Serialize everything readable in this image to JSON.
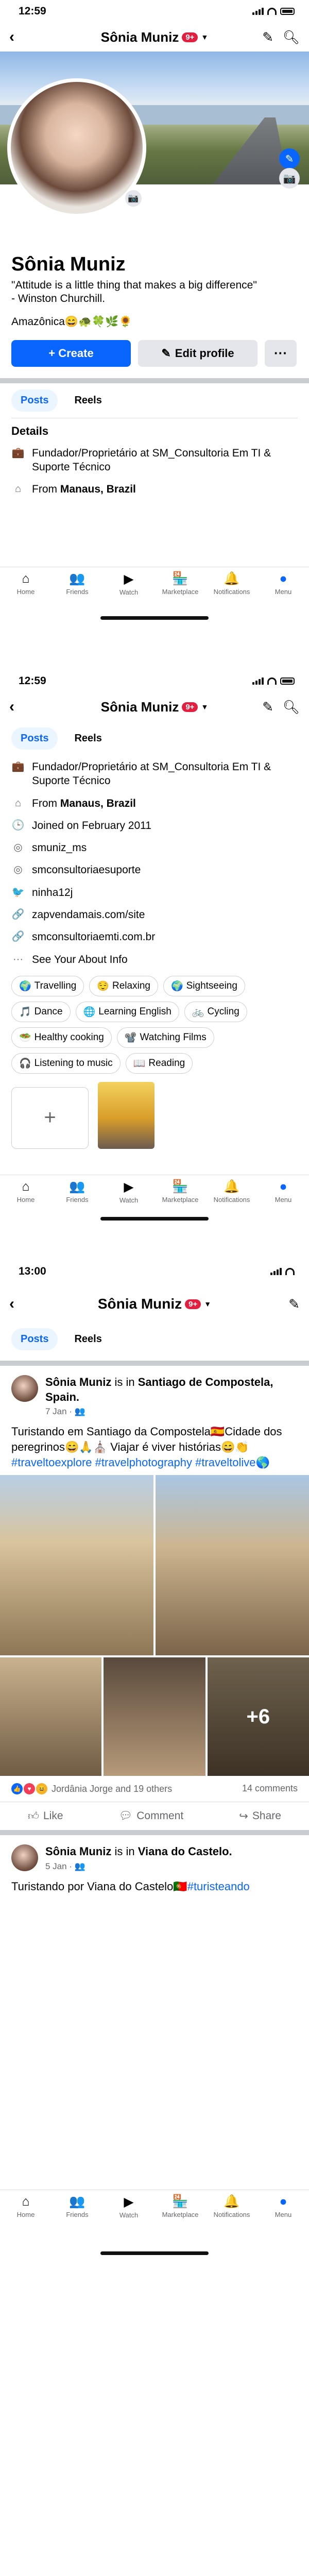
{
  "status": {
    "time_1": "12:59",
    "time_2": "12:59",
    "time_3": "13:00"
  },
  "profile": {
    "name": "Sônia Muniz",
    "badge": "9+",
    "bio": "\"Attitude is a little thing that makes a big difference\"\n- Winston Churchill.",
    "bio_emoji": "Amazônica😄🐢🍀🌿🌻",
    "create_label": "+ Create",
    "edit_label": "Edit profile",
    "more_label": "···"
  },
  "tabs": {
    "posts": "Posts",
    "reels": "Reels"
  },
  "details": {
    "title": "Details",
    "work": "Fundador/Proprietário at SM_Consultoria Em TI & Suporte Técnico",
    "from_prefix": "From ",
    "from_place": "Manaus, Brazil",
    "joined": "Joined on February 2011",
    "instagram": "smuniz_ms",
    "instagram2": "smconsultoriaesuporte",
    "twitter": "ninha12j",
    "link1": "zapvendamais.com/site",
    "link2": "smconsultoriaemti.com.br",
    "see_about": "See Your About Info"
  },
  "hobbies": [
    {
      "icon": "🌍",
      "label": "Travelling"
    },
    {
      "icon": "😌",
      "label": "Relaxing"
    },
    {
      "icon": "🌍",
      "label": "Sightseeing"
    },
    {
      "icon": "🎵",
      "label": "Dance"
    },
    {
      "icon": "🌐",
      "label": "Learning English"
    },
    {
      "icon": "🚲",
      "label": "Cycling"
    },
    {
      "icon": "🥗",
      "label": "Healthy cooking"
    },
    {
      "icon": "📽️",
      "label": "Watching Films"
    },
    {
      "icon": "🎧",
      "label": "Listening to music"
    },
    {
      "icon": "📖",
      "label": "Reading"
    }
  ],
  "tabbar": [
    {
      "icon": "⌂",
      "label": "Home"
    },
    {
      "icon": "👥",
      "label": "Friends"
    },
    {
      "icon": "▶",
      "label": "Watch"
    },
    {
      "icon": "🏪",
      "label": "Marketplace"
    },
    {
      "icon": "🔔",
      "label": "Notifications"
    },
    {
      "icon": "●",
      "label": "Menu"
    }
  ],
  "post1": {
    "author": "Sônia Muniz",
    "is_in": " is in ",
    "place": "Santiago de Compostela, Spain.",
    "date": "7 Jan · 👥",
    "text": "Turistando em Santiago da Compostela🇪🇸Cidade dos peregrinos😄🙏⛪ Viajar é viver histórias😄👏",
    "tags": "#traveltoexplore #travelphotography #traveltolive🌎",
    "more_photos": "+6",
    "reactions": "Jordânia Jorge and 19 others",
    "comments": "14 comments",
    "like": "Like",
    "comment": "Comment",
    "share": "Share"
  },
  "post2": {
    "author": "Sônia Muniz",
    "is_in": " is in ",
    "place": "Viana do Castelo.",
    "date": "5 Jan · 👥",
    "text": "Turistando por Viana do Castelo🇵🇹",
    "tags": "#turisteando"
  }
}
